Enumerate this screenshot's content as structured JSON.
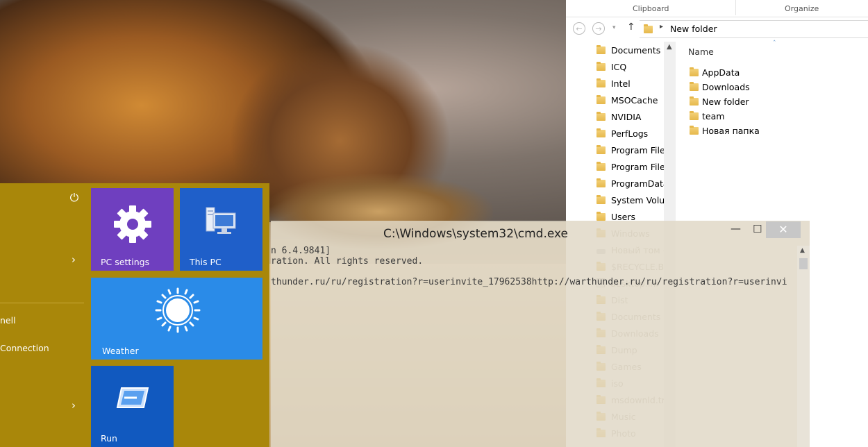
{
  "start_menu": {
    "items": [
      "nell",
      "Connection"
    ],
    "tiles": {
      "settings": "PC settings",
      "thispc": "This PC",
      "weather": "Weather",
      "run": "Run"
    }
  },
  "explorer": {
    "ribbon": {
      "clipboard": "Clipboard",
      "organize": "Organize"
    },
    "address": "New folder",
    "tree": [
      "Documents a",
      "ICQ",
      "Intel",
      "MSOCache",
      "NVIDIA",
      "PerfLogs",
      "Program File",
      "Program File",
      "ProgramData",
      "System Volur",
      "Users",
      "Windows",
      "Новый том (D:)",
      "$RECYCLE.BIN",
      "desktop.ini",
      "Dist",
      "Documents",
      "Downloads",
      "Dump",
      "Games",
      "iso",
      "msdownld.tm",
      "Music",
      "Photo"
    ],
    "column_name": "Name",
    "files": [
      "AppData",
      "Downloads",
      "New folder",
      "team",
      "Новая папка"
    ]
  },
  "cmd": {
    "title": "C:\\Windows\\system32\\cmd.exe",
    "lines": [
      "n 6.4.9841]",
      "ration. All rights reserved.",
      "",
      "thunder.ru/ru/registration?r=userinvite_17962538http://warthunder.ru/ru/registration?r=userinvi"
    ]
  }
}
